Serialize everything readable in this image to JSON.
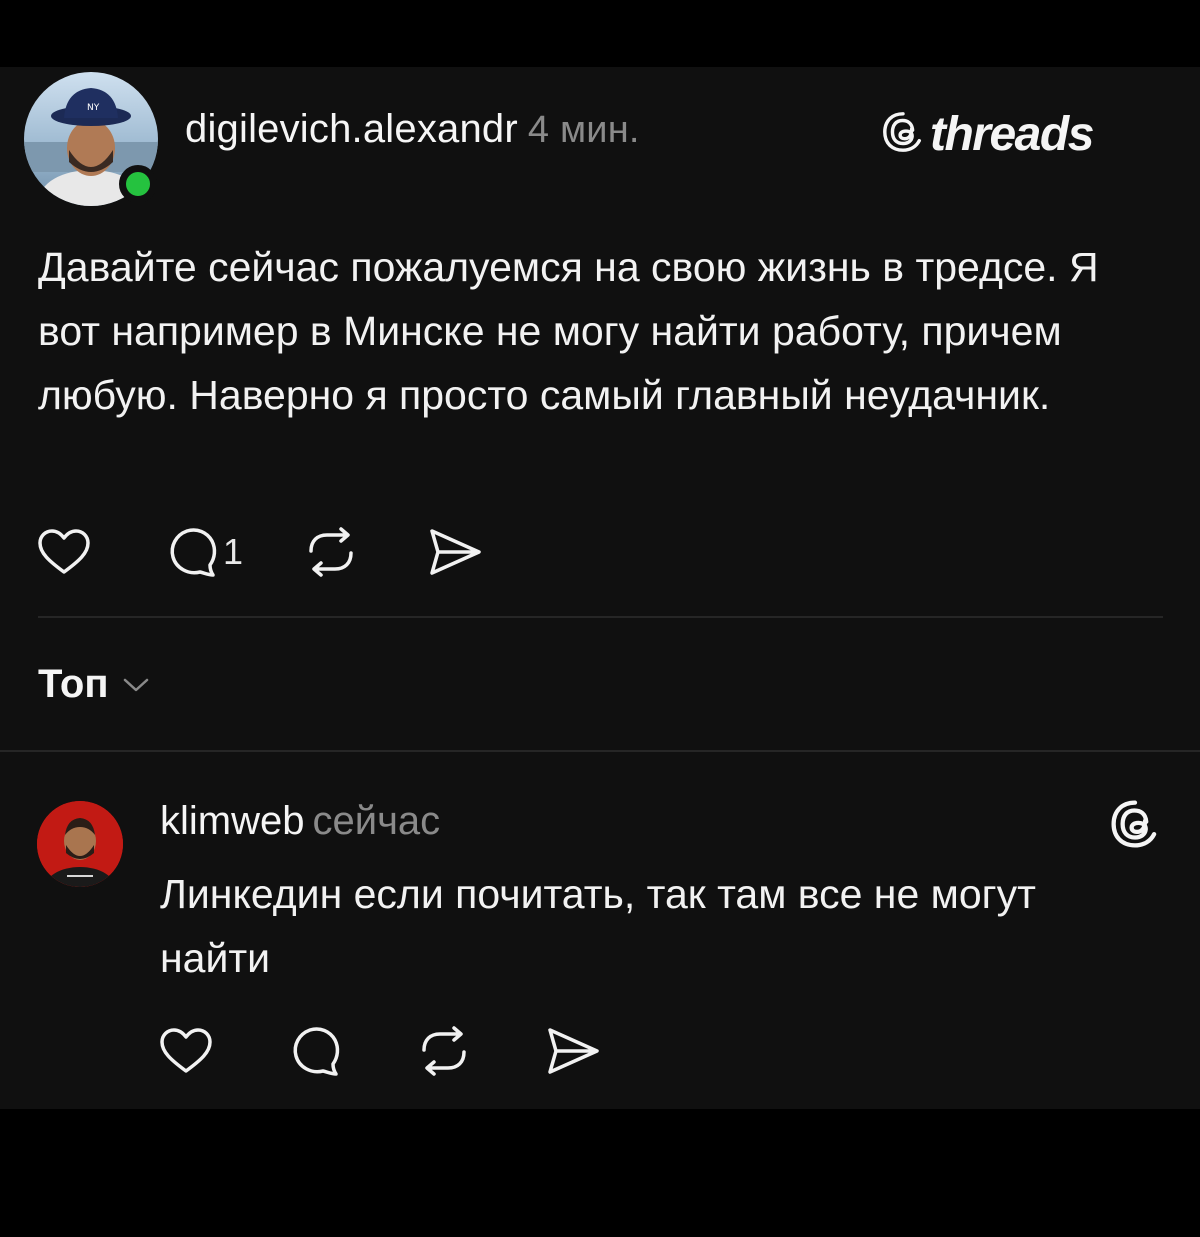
{
  "post": {
    "author": "digilevich.alexandr",
    "time": "4 мин.",
    "brand": "threads",
    "text": "Давайте сейчас пожалуемся на свою жизнь в тредсе. Я вот например в Минске не могу найти работу, причем любую. Наверно я просто самый главный неудачник.",
    "reply_count": "1",
    "online_color": "#25c23f"
  },
  "sort": {
    "label": "Топ"
  },
  "reply": {
    "author": "klimweb",
    "time": "сейчас",
    "text": "Линкедин если почитать, так там все не могут найти",
    "avatar_color": "#c21a14"
  },
  "icons": [
    "like-icon",
    "comment-icon",
    "repost-icon",
    "share-icon",
    "chevron-down-icon",
    "threads-logo-icon"
  ]
}
